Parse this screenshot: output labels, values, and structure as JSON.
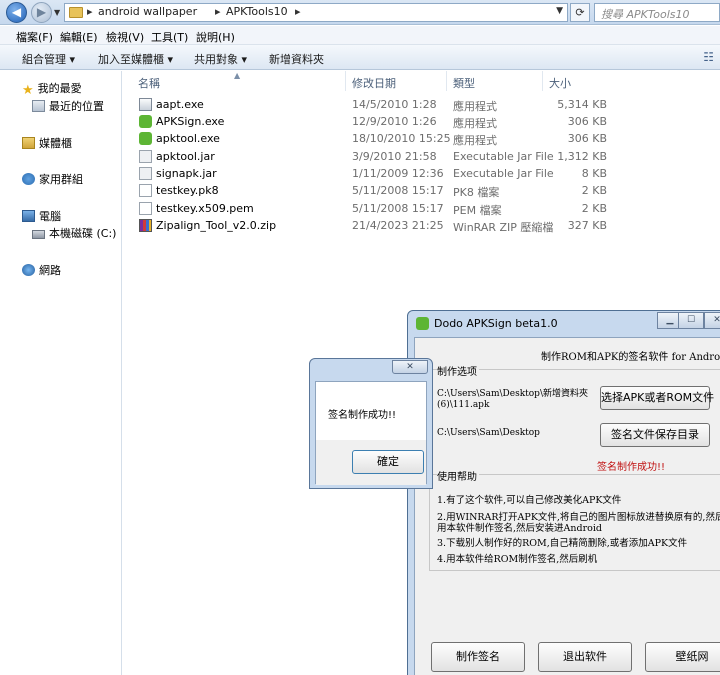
{
  "explorer": {
    "breadcrumbs": [
      "android wallpaper",
      "APKTools10"
    ],
    "search_placeholder": "搜尋 APKTools10",
    "menu": [
      "檔案(F)",
      "編輯(E)",
      "檢視(V)",
      "工具(T)",
      "說明(H)"
    ],
    "toolbar": {
      "organize": "組合管理 ▾",
      "add_library": "加入至媒體櫃 ▾",
      "share": "共用對象 ▾",
      "new_folder": "新增資料夾"
    },
    "nav": {
      "favorites": "我的最愛",
      "recent": "最近的位置",
      "libraries": "媒體櫃",
      "homegroup": "家用群組",
      "computer": "電腦",
      "local_disk": "本機磁碟 (C:)",
      "network": "網路"
    },
    "columns": {
      "name": "名稱",
      "date": "修改日期",
      "type": "類型",
      "size": "大小"
    },
    "files": [
      {
        "name": "aapt.exe",
        "date": "14/5/2010 1:28",
        "type": "應用程式",
        "size": "5,314 KB",
        "icon": "exe-icon"
      },
      {
        "name": "APKSign.exe",
        "date": "12/9/2010 1:26",
        "type": "應用程式",
        "size": "306 KB",
        "icon": "android-icon"
      },
      {
        "name": "apktool.exe",
        "date": "18/10/2010 15:25",
        "type": "應用程式",
        "size": "306 KB",
        "icon": "android-icon"
      },
      {
        "name": "apktool.jar",
        "date": "3/9/2010 21:58",
        "type": "Executable Jar File",
        "size": "1,312 KB",
        "icon": "jar-icon"
      },
      {
        "name": "signapk.jar",
        "date": "1/11/2009 12:36",
        "type": "Executable Jar File",
        "size": "8 KB",
        "icon": "jar-icon"
      },
      {
        "name": "testkey.pk8",
        "date": "5/11/2008 15:17",
        "type": "PK8 檔案",
        "size": "2 KB",
        "icon": "doc-icon"
      },
      {
        "name": "testkey.x509.pem",
        "date": "5/11/2008 15:17",
        "type": "PEM 檔案",
        "size": "2 KB",
        "icon": "doc-icon"
      },
      {
        "name": "Zipalign_Tool_v2.0.zip",
        "date": "21/4/2023 21:25",
        "type": "WinRAR ZIP 壓縮檔",
        "size": "327 KB",
        "icon": "zip-icon"
      }
    ]
  },
  "apksign": {
    "title": "Dodo APKSign beta1.0",
    "headline": "制作ROM和APK的签名软件 for Android",
    "options_label": "制作选项",
    "path1": "C:\\Users\\Sam\\Desktop\\新增資料夾\n(6)\\111.apk",
    "path2": "C:\\Users\\Sam\\Desktop",
    "btn_select": "选择APK或者ROM文件",
    "btn_save_dir": "签名文件保存目录",
    "success_text": "签名制作成功!!",
    "help_label": "使用帮助",
    "help": [
      "1.有了这个软件,可以自己修改美化APK文件",
      "2.用WINRAR打开APK文件,将自己的图片图标放进替换原有的,然后用本软件制作签名,然后安装进Android",
      "3.下载别人制作好的ROM,自己精简删除,或者添加APK文件",
      "4.用本软件给ROM制作签名,然后刷机"
    ],
    "btn_make": "制作签名",
    "btn_exit": "退出软件",
    "btn_wallpaper": "壁纸网"
  },
  "dialog": {
    "message": "签名制作成功!!",
    "ok": "確定"
  }
}
